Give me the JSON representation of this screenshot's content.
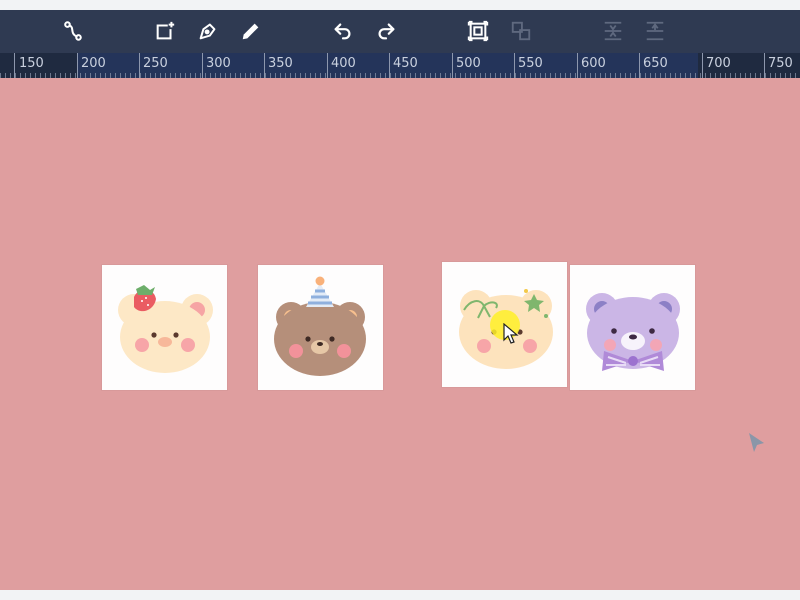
{
  "toolbar": {
    "tools": [
      {
        "name": "connector-tool",
        "icon": "connector-icon"
      },
      {
        "name": "add-shape-tool",
        "icon": "add-frame-icon"
      },
      {
        "name": "pen-tool",
        "icon": "pen-nib-icon"
      },
      {
        "name": "pencil-tool",
        "icon": "pencil-icon"
      },
      {
        "name": "undo-button",
        "icon": "undo-icon"
      },
      {
        "name": "redo-button",
        "icon": "redo-icon"
      },
      {
        "name": "group-button",
        "icon": "group-icon"
      },
      {
        "name": "ungroup-button",
        "icon": "ungroup-icon",
        "disabled": true
      },
      {
        "name": "align-middle-button",
        "icon": "align-middle-icon",
        "disabled": true
      },
      {
        "name": "align-top-button",
        "icon": "align-top-icon",
        "disabled": true
      }
    ]
  },
  "ruler": {
    "labels": [
      "150",
      "200",
      "250",
      "300",
      "350",
      "400",
      "450",
      "500",
      "550",
      "600",
      "650",
      "700",
      "750"
    ]
  },
  "canvas": {
    "background": "#df9e9f",
    "stickers": [
      {
        "name": "sticker-strawberry-bear"
      },
      {
        "name": "sticker-party-hat-bear"
      },
      {
        "name": "sticker-ribbon-bear"
      },
      {
        "name": "sticker-bowtie-bear"
      }
    ]
  },
  "colors": {
    "toolbar": "#2f3a52",
    "ruler": "#1f2a40",
    "ruler_highlight": "#24345a"
  }
}
